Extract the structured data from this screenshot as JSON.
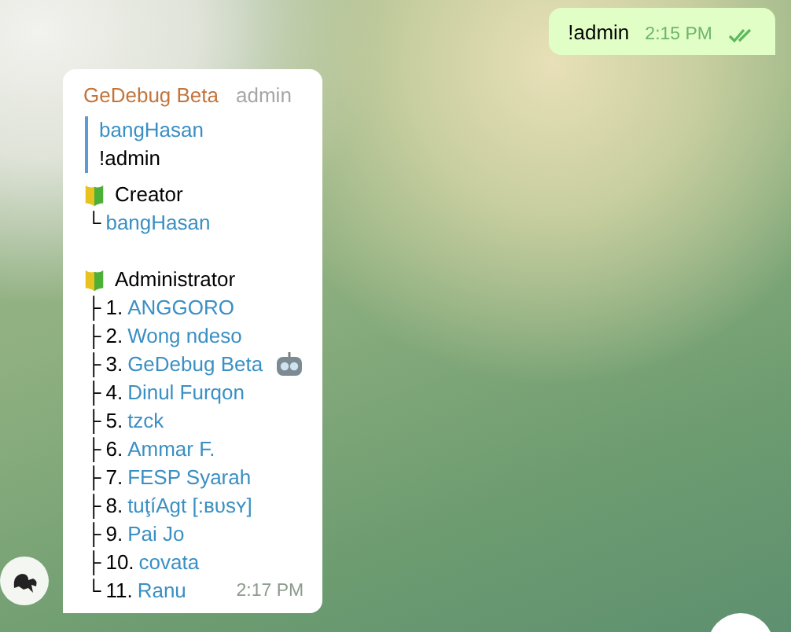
{
  "messages": [
    {
      "kind": "outgoing",
      "text": "!admin",
      "time": "2:15 PM",
      "read": true
    },
    {
      "kind": "incoming",
      "sender": "GeDebug Beta",
      "sender_badge": "admin",
      "reply": {
        "author": "bangHasan",
        "text": "!admin"
      },
      "time": "2:17 PM",
      "sections": [
        {
          "title": "Creator",
          "members": [
            {
              "prefix": "└",
              "name": "bangHasan",
              "bot": false
            }
          ]
        },
        {
          "title": "Administrator",
          "members": [
            {
              "prefix": "├",
              "number": "1.",
              "name": "ANGGORO",
              "bot": false
            },
            {
              "prefix": "├",
              "number": "2.",
              "name": "Wong ndeso",
              "bot": false
            },
            {
              "prefix": "├",
              "number": "3.",
              "name": "GeDebug Beta",
              "bot": true
            },
            {
              "prefix": "├",
              "number": "4.",
              "name": "Dinul Furqon",
              "bot": false
            },
            {
              "prefix": "├",
              "number": "5.",
              "name": "tzck",
              "bot": false
            },
            {
              "prefix": "├",
              "number": "6.",
              "name": "Ammar F.",
              "bot": false
            },
            {
              "prefix": "├",
              "number": "7.",
              "name": "FESP Syarah",
              "bot": false
            },
            {
              "prefix": "├",
              "number": "8.",
              "name": "tuţíAgt [:ʙᴜsʏ]",
              "bot": false
            },
            {
              "prefix": "├",
              "number": "9.",
              "name": "Pai Jo",
              "bot": false
            },
            {
              "prefix": "├",
              "number": "10.",
              "name": "covata",
              "bot": false
            },
            {
              "prefix": "└",
              "number": "11.",
              "name": "Ranu",
              "bot": false
            }
          ]
        }
      ]
    }
  ]
}
